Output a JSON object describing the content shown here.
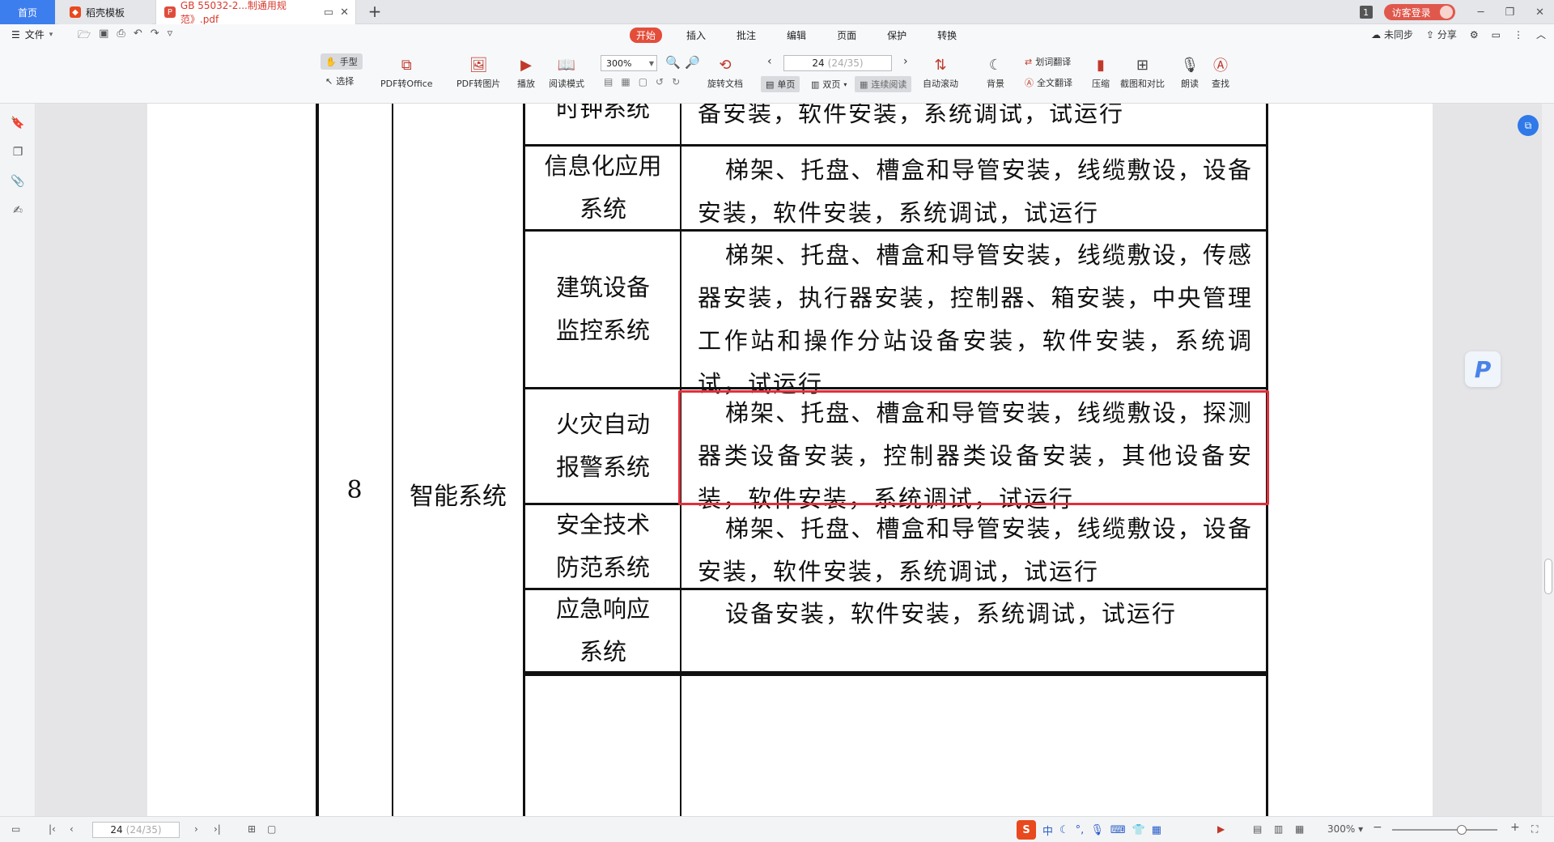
{
  "tabs": {
    "home": "首页",
    "template": "稻壳模板",
    "pdf": "GB 55032-2...制通用规范》.pdf",
    "new_tab": "+"
  },
  "titlebar": {
    "badge": "1",
    "login": "访客登录"
  },
  "ribbon": {
    "file": "文件",
    "menu_tabs": [
      "开始",
      "插入",
      "批注",
      "编辑",
      "页面",
      "保护",
      "转换"
    ],
    "active_tab": "开始",
    "right": {
      "sync": "未同步",
      "share": "分享"
    },
    "tools": {
      "hand": "手型",
      "select": "选择",
      "pdf_to_office": "PDF转Office",
      "pdf_to_image": "PDF转图片",
      "play": "播放",
      "read_mode": "阅读模式",
      "zoom": "300%",
      "rotate": "旋转文档",
      "page_current": "24",
      "page_total": "(24/35)",
      "single_page": "单页",
      "double_page": "双页",
      "continuous": "连续阅读",
      "auto_scroll": "自动滚动",
      "background": "背景",
      "word_translate": "划词翻译",
      "full_translate": "全文翻译",
      "compress": "压缩",
      "screenshot_compare": "截图和对比",
      "read_aloud": "朗读",
      "find": "查找"
    }
  },
  "document": {
    "number": "8",
    "category": "智能系统",
    "rows": [
      {
        "system": [
          "时钟系统"
        ],
        "desc": "备安装，软件安装，系统调试，试运行",
        "partial": true
      },
      {
        "system": [
          "信息化应用",
          "系统"
        ],
        "desc": "梯架、托盘、槽盒和导管安装，线缆敷设，设备安装，软件安装，系统调试，试运行"
      },
      {
        "system": [
          "建筑设备",
          "监控系统"
        ],
        "desc": "梯架、托盘、槽盒和导管安装，线缆敷设，传感器安装，执行器安装，控制器、箱安装，中央管理工作站和操作分站设备安装，软件安装，系统调试，试运行"
      },
      {
        "system": [
          "火灾自动",
          "报警系统"
        ],
        "desc": "梯架、托盘、槽盒和导管安装，线缆敷设，探测器类设备安装，控制器类设备安装，其他设备安装，软件安装，系统调试，试运行",
        "highlighted": true
      },
      {
        "system": [
          "安全技术",
          "防范系统"
        ],
        "desc": "梯架、托盘、槽盒和导管安装，线缆敷设，设备安装，软件安装，系统调试，试运行"
      },
      {
        "system": [
          "应急响应",
          "系统"
        ],
        "desc": "设备安装，软件安装，系统调试，试运行"
      }
    ]
  },
  "statusbar": {
    "page_current": "24",
    "page_total": "(24/35)",
    "zoom": "300%",
    "ime": "中"
  },
  "colors": {
    "accent": "#e44d3a",
    "highlight_border": "#e0303a",
    "home_tab": "#3d7eef"
  }
}
